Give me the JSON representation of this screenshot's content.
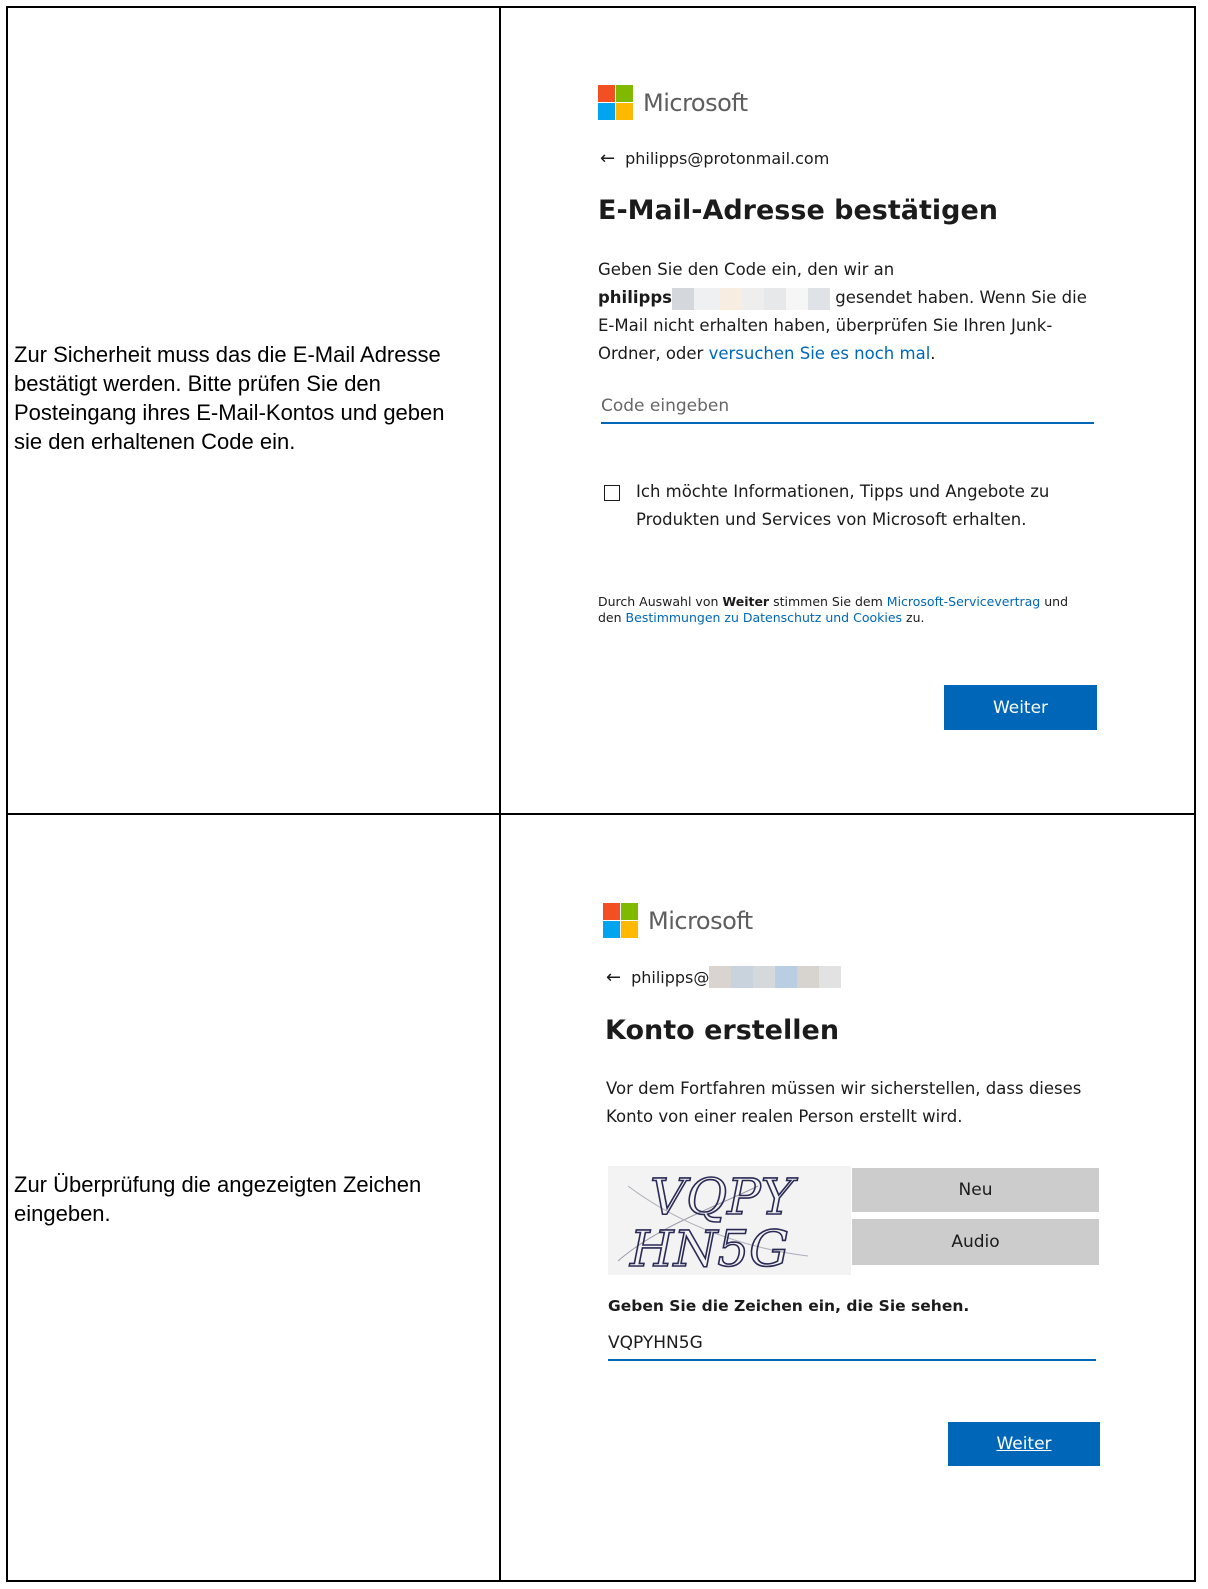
{
  "colors": {
    "ms_red": "#f25022",
    "ms_green": "#7fba00",
    "ms_blue": "#00a4ef",
    "ms_yellow": "#ffb900",
    "accent_blue": "#0067b8",
    "button_gray": "#cccccc"
  },
  "row1": {
    "instruction": "Zur Sicherheit muss das die E-Mail Adresse bestätigt werden. Bitte prüfen Sie den Posteingang ihres E-Mail-Kontos und geben sie den erhaltenen Code ein.",
    "logo_text": "Microsoft",
    "back_icon": "←",
    "identity": "philipps@protonmail.com",
    "heading": "E-Mail-Adresse bestätigen",
    "para_prefix": "Geben Sie den Code ein, den wir an",
    "para_email_visible": "philipps",
    "para_sent": "gesendet haben. Wenn Sie die E-Mail nicht erhalten haben, überprüfen Sie Ihren Junk-Ordner, oder",
    "para_link": "versuchen Sie es noch mal",
    "para_end": ".",
    "code_placeholder": "Code eingeben",
    "checkbox_label": "Ich möchte Informationen, Tipps und Angebote zu Produkten und Services von Microsoft erhalten.",
    "terms_prefix": "Durch Auswahl von",
    "terms_bold": "Weiter",
    "terms_mid": "stimmen Sie dem",
    "terms_link1": "Microsoft-Servicevertrag",
    "terms_and": "und den",
    "terms_link2": "Bestimmungen zu Datenschutz und Cookies",
    "terms_end": "zu.",
    "next_button": "Weiter"
  },
  "row2": {
    "instruction": "Zur Überprüfung die angezeigten Zeichen eingeben.",
    "logo_text": "Microsoft",
    "back_icon": "←",
    "identity": "philipps@",
    "heading": "Konto erstellen",
    "paragraph": "Vor dem Fortfahren müssen wir sicherstellen, dass dieses Konto von einer realen Person erstellt wird.",
    "captcha_line1": "VQPY",
    "captcha_line2": "HN5G",
    "new_button": "Neu",
    "audio_button": "Audio",
    "captcha_label": "Geben Sie die Zeichen ein, die Sie sehen.",
    "captcha_value": "VQPYHN5G",
    "next_button": "Weiter"
  }
}
